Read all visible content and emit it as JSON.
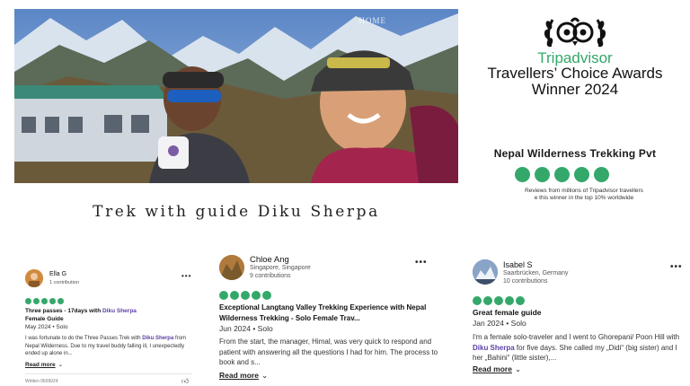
{
  "hero": {
    "watermark": "HOME"
  },
  "award": {
    "brand": "Tripadvisor",
    "line1": "Travellers’ Choice Awards",
    "line2": "Winner 2024",
    "brand_color": "#34a86a"
  },
  "company": {
    "name": "Nepal Wilderness Trekking Pvt",
    "rating_bubbles": 5,
    "note_line1": "Reviews from millions of Tripadvisor travellers",
    "note_line2": "e this winner in the top 10% worldwide"
  },
  "caption": "Trek with guide Diku Sherpa",
  "reviews": [
    {
      "name": "Ella G",
      "contributions": "1 contribution",
      "more": "•••",
      "rating": 5,
      "title_prefix": "Three passes - 17days with ",
      "title_highlight": "Diku Sherpa",
      "title_suffix": "Female Guide",
      "date": "May 2024 • Solo",
      "body_prefix": "I was fortunate to do the Three Passes Trek with ",
      "body_highlight": "Diku Sherpa",
      "body_suffix": " from Nepal Wilderness. Due to my travel buddy falling ill, I unexpectedly ended up alone in...",
      "read_more": "Read more",
      "written": "Written 06/06/24"
    },
    {
      "name": "Chloe Ang",
      "location": "Singapore, Singapore",
      "contributions": "9 contributions",
      "more": "•••",
      "rating": 5,
      "title": "Exceptional Langtang Valley Trekking Experience with Nepal Wilderness Trekking - Solo Female Trav...",
      "date": "Jun 2024 • Solo",
      "body": "From the start, the manager, Himal, was very quick to respond and patient with answering all the questions I had for him. The process to book and s...",
      "read_more": "Read more"
    },
    {
      "name": "Isabel S",
      "location": "Saarbrücken, Germany",
      "contributions": "10 contributions",
      "more": "•••",
      "rating": 5,
      "title": "Great female guide",
      "date": "Jan 2024 • Solo",
      "body_prefix": "I'm a female solo-traveler and I went to Ghorepani/ Poon Hill with ",
      "body_highlight": "Diku Sherpa",
      "body_suffix": " for five days. She called my „Didi“ (big sister) and I her „Bahini“ (little sister),...",
      "read_more": "Read more"
    }
  ]
}
